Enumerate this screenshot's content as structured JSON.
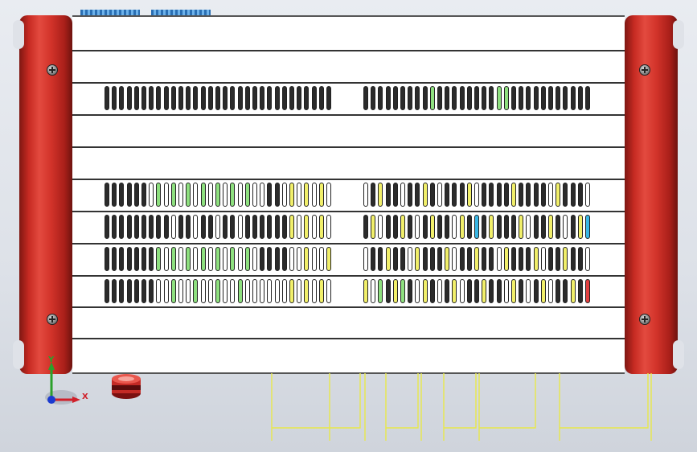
{
  "viewport": {
    "background_top": "#e9ecf1",
    "background_bottom": "#cfd4dc"
  },
  "model": {
    "rail_color": "#d2332a",
    "panel_color": "#ffffff",
    "screw_count": 4,
    "divider_count": 10,
    "vent_rows": 5,
    "slot_palette": {
      "dark": "#2b2b2b",
      "white": "#ffffff",
      "green": "#8ee07f",
      "yellow": "#f1ef6a",
      "cyan": "#39b6e4",
      "red": "#e24040"
    }
  },
  "triad": {
    "x_label": "X",
    "y_label": "Y",
    "x_color": "#d0202a",
    "y_color": "#2ba02b",
    "z_color": "#1a3ad0"
  },
  "sketch": {
    "line_color": "#e8e84a"
  }
}
